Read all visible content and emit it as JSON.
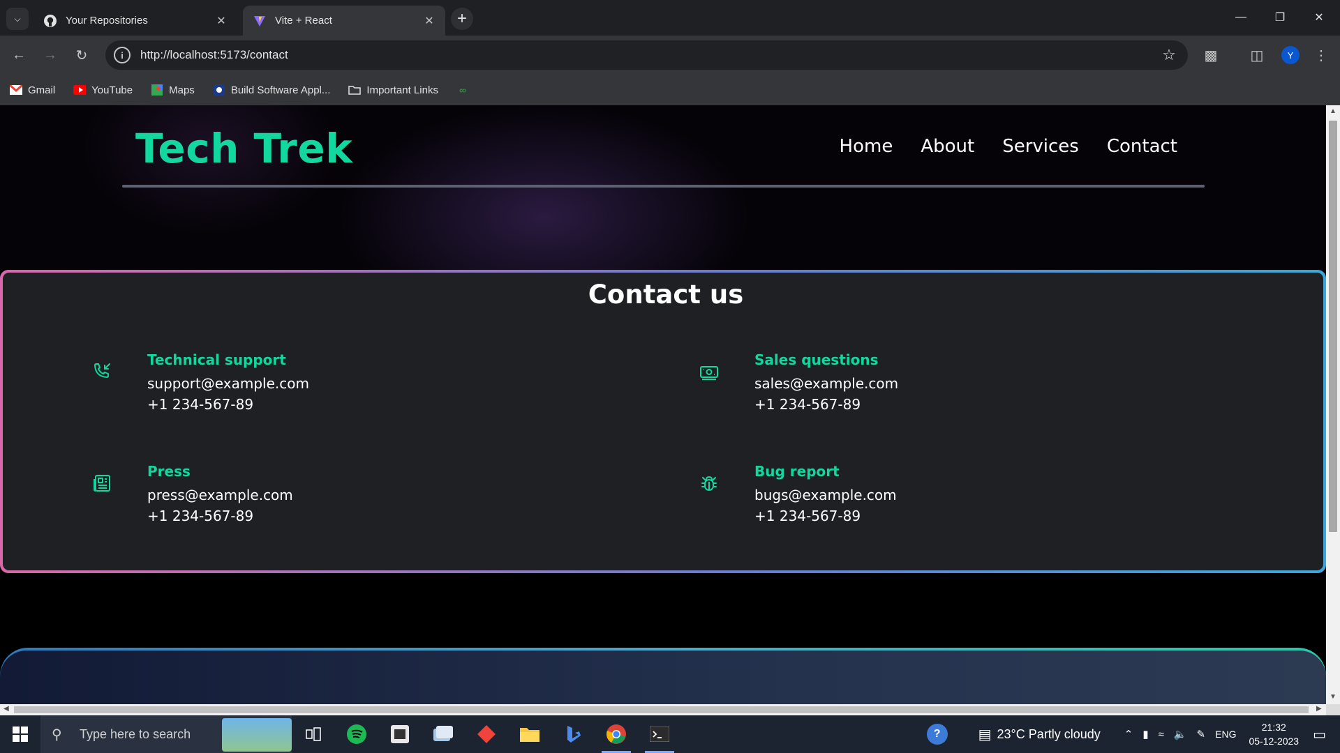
{
  "browser": {
    "tabs": [
      {
        "title": "Your Repositories",
        "active": false,
        "icon": "github-icon"
      },
      {
        "title": "Vite + React",
        "active": true,
        "icon": "vite-icon"
      }
    ],
    "url": "http://localhost:5173/contact",
    "bookmarks": [
      {
        "label": "Gmail",
        "icon": "gmail-icon"
      },
      {
        "label": "YouTube",
        "icon": "youtube-icon"
      },
      {
        "label": "Maps",
        "icon": "maps-icon"
      },
      {
        "label": "Build Software Appl...",
        "icon": "build-icon"
      },
      {
        "label": "Important Links",
        "icon": "folder-icon"
      }
    ],
    "profile_initial": "Y"
  },
  "site": {
    "brand": "Tech Trek",
    "nav": [
      "Home",
      "About",
      "Services",
      "Contact"
    ],
    "contact_title": "Contact us",
    "cards": [
      {
        "title": "Technical support",
        "email": "support@example.com",
        "phone": "+1 234-567-89",
        "icon": "phone-icon"
      },
      {
        "title": "Sales questions",
        "email": "sales@example.com",
        "phone": "+1 234-567-89",
        "icon": "money-icon"
      },
      {
        "title": "Press",
        "email": "press@example.com",
        "phone": "+1 234-567-89",
        "icon": "newspaper-icon"
      },
      {
        "title": "Bug report",
        "email": "bugs@example.com",
        "phone": "+1 234-567-89",
        "icon": "bug-icon"
      }
    ],
    "accent": "#12d8a0"
  },
  "taskbar": {
    "search_placeholder": "Type here to search",
    "weather": "23°C  Partly cloudy",
    "lang": "ENG",
    "time": "21:32",
    "date": "05-12-2023"
  }
}
